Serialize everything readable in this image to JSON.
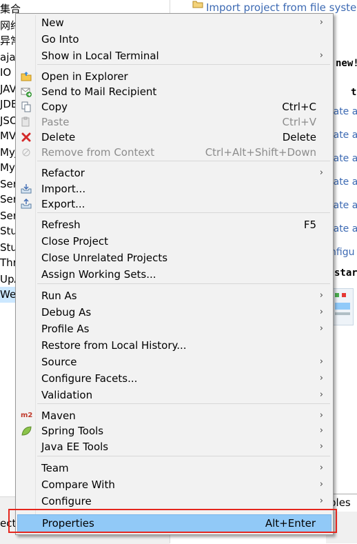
{
  "explorer": {
    "items": [
      "集合",
      "网络",
      "异常",
      "ajax",
      "IO",
      "JAV",
      "JDB",
      "JSO",
      "MV",
      "MyJ",
      "MyW",
      "Serv",
      "Serv",
      "Serv",
      "Stud",
      "Stud",
      "Thre",
      "UpA",
      "Wel"
    ],
    "bottom_label": "ect"
  },
  "right_pane": {
    "import_link": "Import project from file system",
    "bold_lines": [
      "new!",
      "t do",
      "star"
    ],
    "links": [
      "eate a",
      "eate a",
      "eate a",
      "eate a",
      "eate a",
      "eate a",
      "nfigu"
    ],
    "tab_label": "ples"
  },
  "menu": {
    "groups": [
      [
        {
          "label": "New",
          "submenu": true
        },
        {
          "label": "Go Into"
        },
        {
          "label": "Show in Local Terminal",
          "submenu": true
        }
      ],
      [
        {
          "label": "Open in Explorer",
          "icon": "folder-icon"
        },
        {
          "label": "Send to Mail Recipient",
          "icon": "mail-send-icon"
        },
        {
          "label": "Copy",
          "icon": "copy-icon",
          "shortcut": "Ctrl+C"
        },
        {
          "label": "Paste",
          "icon": "paste-icon",
          "shortcut": "Ctrl+V",
          "disabled": true
        },
        {
          "label": "Delete",
          "icon": "delete-icon",
          "shortcut": "Delete"
        },
        {
          "label": "Remove from Context",
          "icon": "remove-context-icon",
          "shortcut": "Ctrl+Alt+Shift+Down",
          "disabled": true
        }
      ],
      [
        {
          "label": "Refactor",
          "submenu": true
        },
        {
          "label": "Import...",
          "icon": "import-icon"
        },
        {
          "label": "Export...",
          "icon": "export-icon"
        }
      ],
      [
        {
          "label": "Refresh",
          "shortcut": "F5"
        },
        {
          "label": "Close Project"
        },
        {
          "label": "Close Unrelated Projects"
        },
        {
          "label": "Assign Working Sets..."
        }
      ],
      [
        {
          "label": "Run As",
          "submenu": true
        },
        {
          "label": "Debug As",
          "submenu": true
        },
        {
          "label": "Profile As",
          "submenu": true
        },
        {
          "label": "Restore from Local History..."
        },
        {
          "label": "Source",
          "submenu": true
        },
        {
          "label": "Configure Facets...",
          "submenu": true
        },
        {
          "label": "Validation",
          "submenu": true
        }
      ],
      [
        {
          "label": "Maven",
          "icon": "maven-icon",
          "icon_text": "m2",
          "submenu": true
        },
        {
          "label": "Spring Tools",
          "icon": "spring-leaf-icon",
          "submenu": true
        },
        {
          "label": "Java EE Tools",
          "submenu": true
        }
      ],
      [
        {
          "label": "Team",
          "submenu": true
        },
        {
          "label": "Compare With",
          "submenu": true
        },
        {
          "label": "Configure",
          "submenu": true
        }
      ],
      [
        {
          "label": "Properties",
          "shortcut": "Alt+Enter",
          "highlighted": true
        }
      ]
    ],
    "arrow_glyph": "›"
  },
  "colors": {
    "menu_bg": "#f2f2f2",
    "highlight": "#91c9f7",
    "focus_outline": "#e5261d",
    "link": "#3d6ab3",
    "disabled_text": "#8c8c8c"
  }
}
